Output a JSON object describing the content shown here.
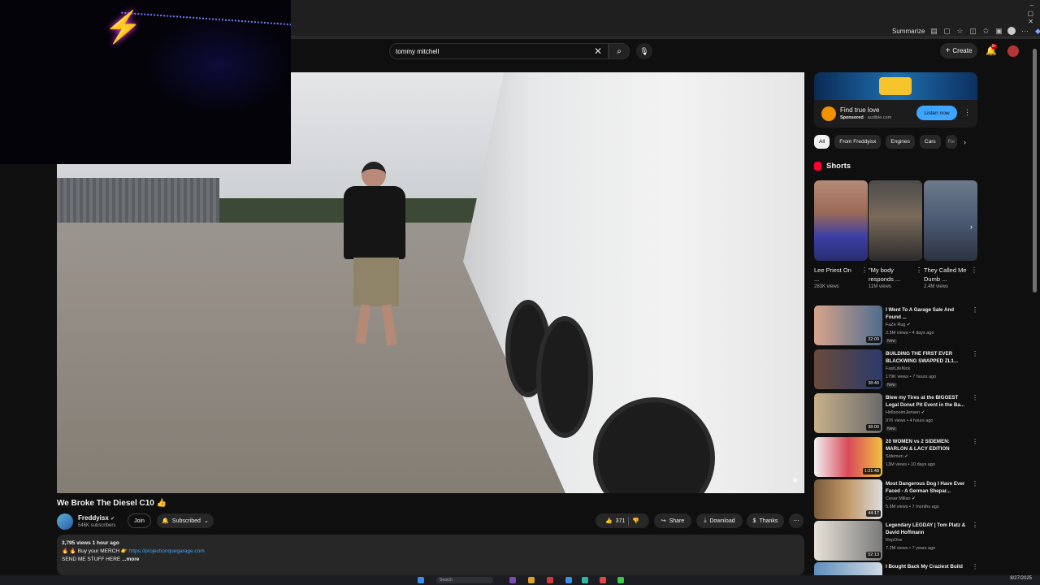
{
  "browser": {
    "summarize_label": "Summarize",
    "window_controls": [
      "–",
      "▢",
      "✕",
      "–",
      "▢",
      "✕"
    ]
  },
  "masthead": {
    "search_value": "tommy mitchell",
    "create_label": "Create",
    "notification_count": "9+"
  },
  "video": {
    "title": "We Broke The Diesel C10 👍",
    "channel": "Freddyisx",
    "subscribers": "546K subscribers",
    "join_label": "Join",
    "subscribed_label": "Subscribed",
    "likes": "371",
    "share_label": "Share",
    "download_label": "Download",
    "thanks_label": "Thanks",
    "views_time": "3,795 views  1 hour ago",
    "merch_text": "🔥 🔥 Buy your MERCH 👉 ",
    "merch_link": "https://projectionquegarage.com",
    "send_text": "SEND ME STUFF HERE ",
    "more_label": "...more"
  },
  "sidebar": {
    "ad": {
      "title": "Find true love",
      "sponsored": "Sponsored",
      "domain": "audible.com",
      "cta": "Listen now"
    },
    "chips": [
      "All",
      "From Freddyisx",
      "Engines",
      "Cars",
      "Re"
    ],
    "shorts_heading": "Shorts",
    "shorts": [
      {
        "title": "Lee Priest On ...",
        "views": "283K views"
      },
      {
        "title": "\"My body responds ...",
        "views": "11M views"
      },
      {
        "title": "They Called Me Dumb ...",
        "views": "2.4M views"
      }
    ],
    "recommendations": [
      {
        "title": "I Went To A Garage Sale And Found ...",
        "channel": "FaZe Rug",
        "meta": "2.5M views • 4 days ago",
        "badge": "New",
        "duration": "32:09"
      },
      {
        "title": "BUILDING THE FIRST EVER BLACKWING SWAPPED ZL1...",
        "channel": "FastLifeNick",
        "meta": "179K views • 7 hours ago",
        "badge": "New",
        "duration": "38:49"
      },
      {
        "title": "Blew my Tires at the BIGGEST Legal Donut Pit Event in the Ba...",
        "channel": "HelloooimJensen",
        "meta": "976 views • 4 hours ago",
        "badge": "New",
        "duration": "38:00"
      },
      {
        "title": "20 WOMEN vs 2 SIDEMEN: MARLON & LACY EDITION",
        "channel": "Sidemen",
        "meta": "13M views • 10 days ago",
        "badge": "",
        "duration": "1:21:48"
      },
      {
        "title": "Most Dangerous Dog I Have Ever Faced - A German Shepar...",
        "channel": "Cesar Millan",
        "meta": "5.6M views • 7 months ago",
        "badge": "",
        "duration": "44:17"
      },
      {
        "title": "Legendary LEGDAY | Tom Platz & David Hoffmann",
        "channel": "RepOne",
        "meta": "7.2M views • 7 years ago",
        "badge": "",
        "duration": "52:13"
      },
      {
        "title": "I Bought Back My Craziest Build",
        "channel": "",
        "meta": "",
        "badge": "",
        "duration": ""
      }
    ]
  },
  "taskbar": {
    "search_label": "Search",
    "date": "8/27/2025"
  },
  "colors": {
    "background": "#0f0f0f",
    "accent_link": "#3ea6ff",
    "brand_red": "#ff0033"
  }
}
